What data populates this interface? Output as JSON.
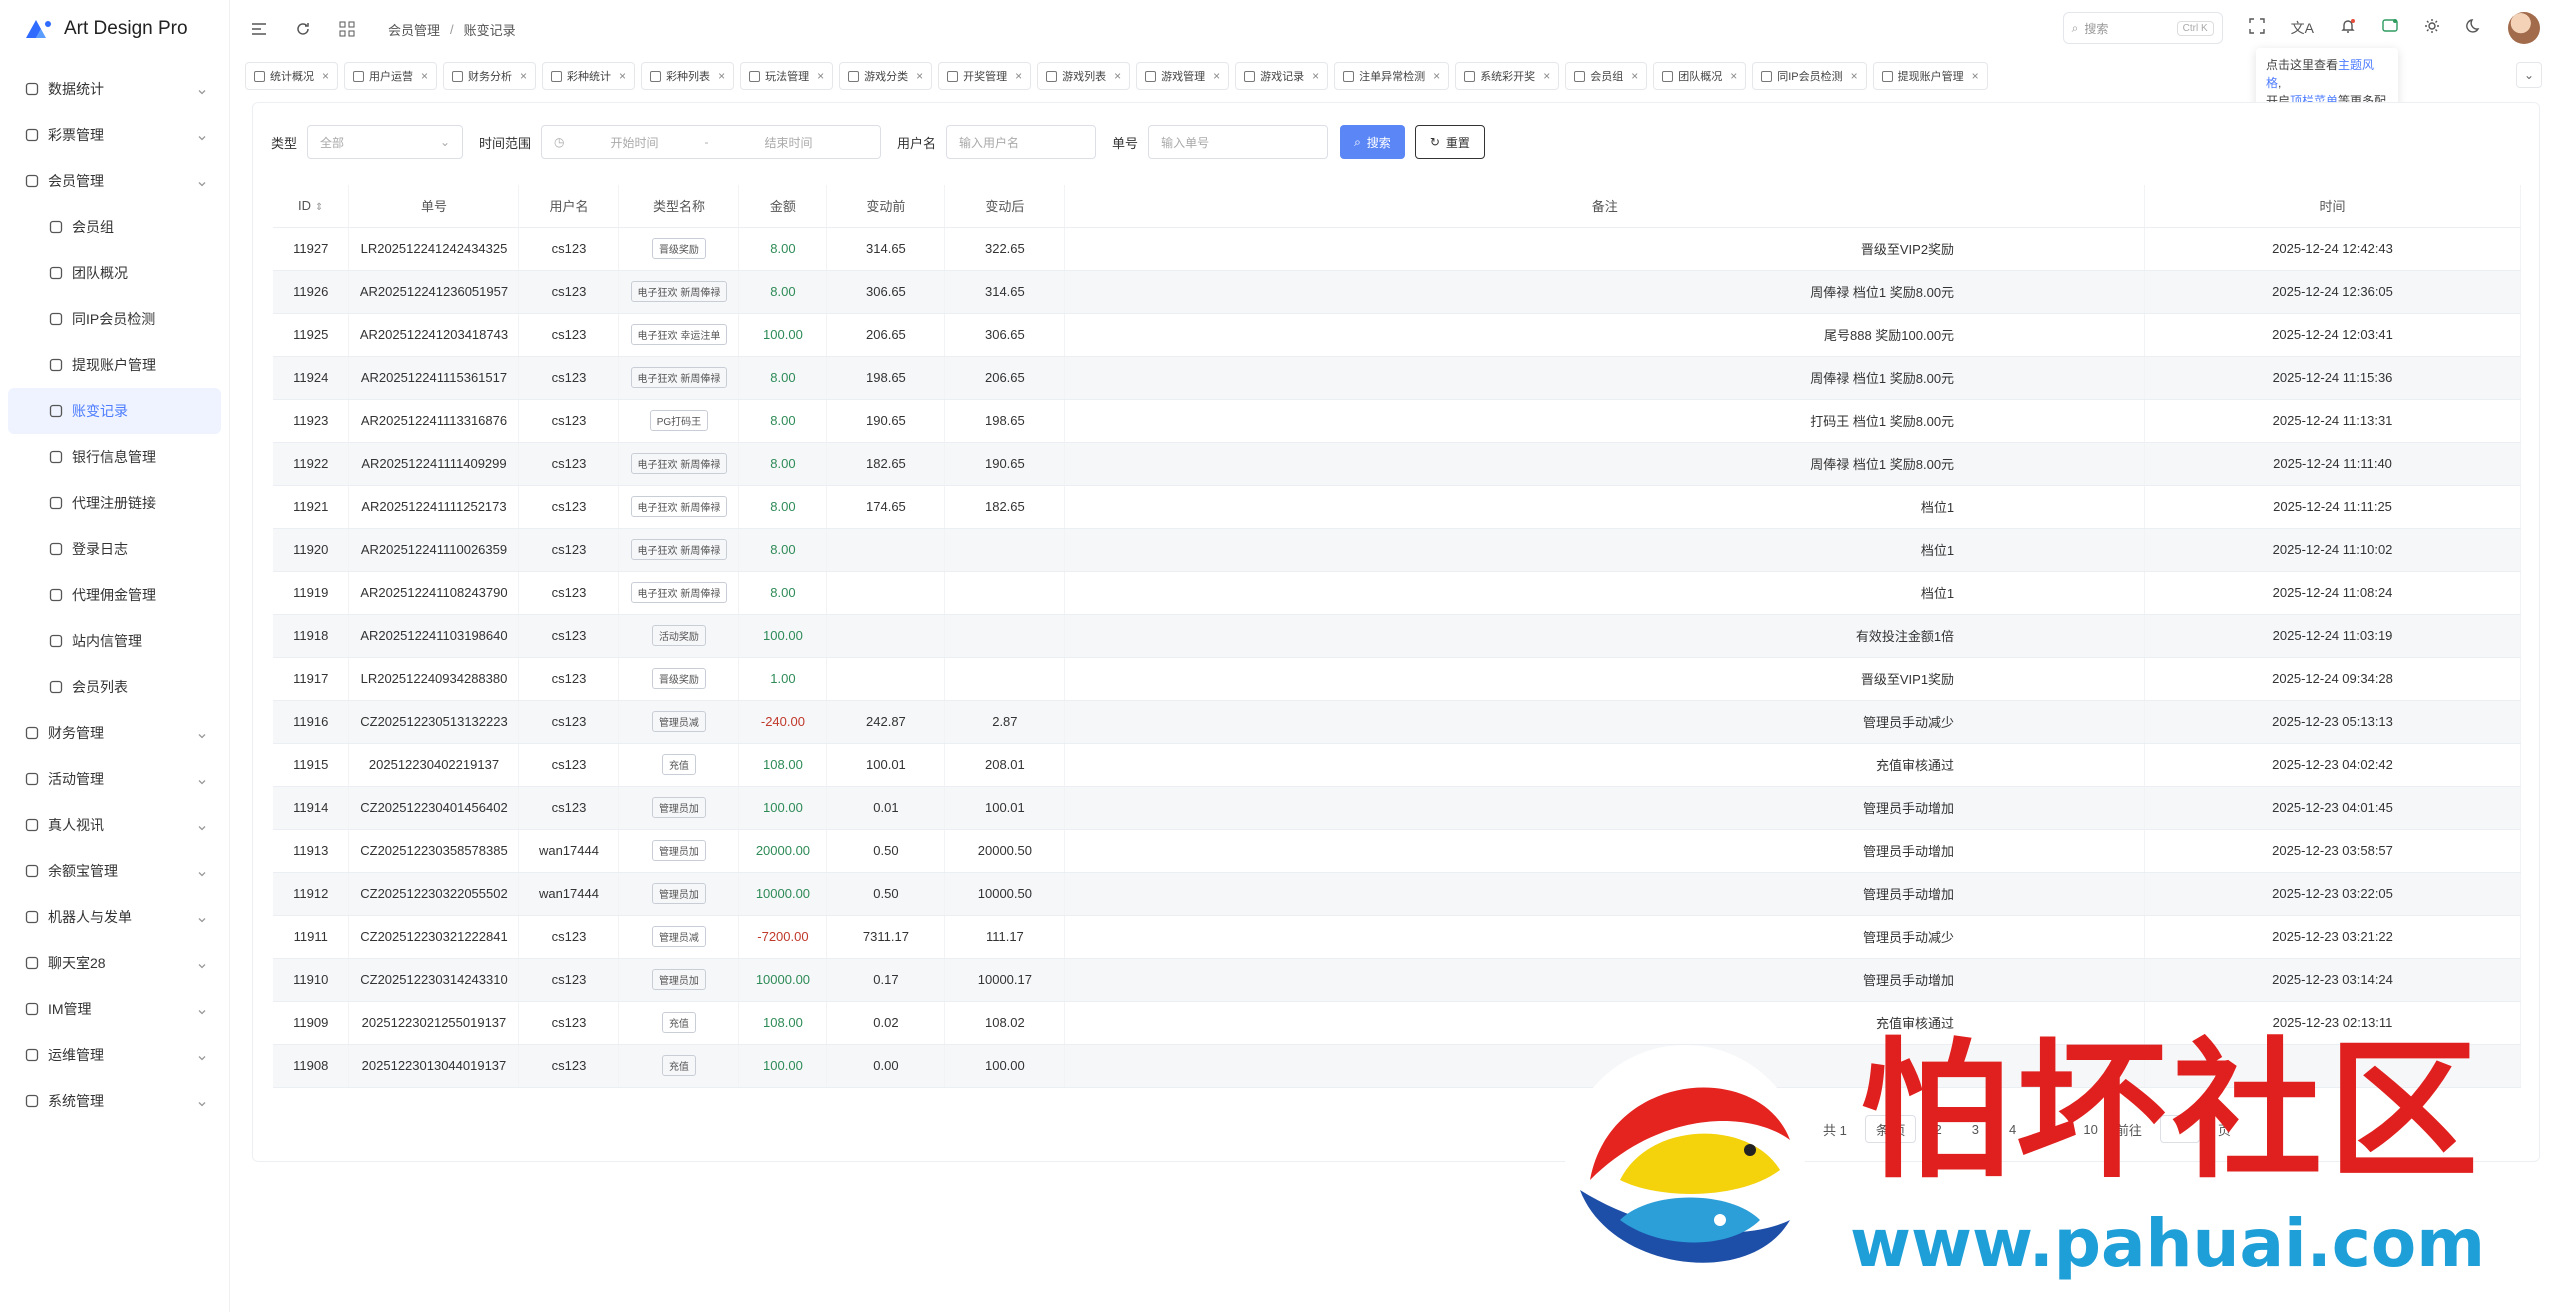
{
  "app": {
    "name": "Art Design Pro",
    "brand_color": "#4d7cff"
  },
  "sidebar": {
    "items": [
      {
        "label": "数据统计",
        "icon": "chart-icon"
      },
      {
        "label": "彩票管理",
        "icon": "ticket-icon"
      },
      {
        "label": "会员管理",
        "icon": "user-icon"
      }
    ],
    "sub_items": [
      {
        "label": "会员组",
        "icon": "users-icon"
      },
      {
        "label": "团队概况",
        "icon": "org-icon"
      },
      {
        "label": "同IP会员检测",
        "icon": "shield-icon"
      },
      {
        "label": "提现账户管理",
        "icon": "card-icon"
      },
      {
        "label": "账变记录",
        "icon": "document-icon"
      },
      {
        "label": "银行信息管理",
        "icon": "bank-icon"
      },
      {
        "label": "代理注册链接",
        "icon": "share-icon"
      },
      {
        "label": "登录日志",
        "icon": "history-icon"
      },
      {
        "label": "代理佣金管理",
        "icon": "coin-icon"
      },
      {
        "label": "站内信管理",
        "icon": "message-icon"
      },
      {
        "label": "会员列表",
        "icon": "user-icon"
      }
    ],
    "bottom_items": [
      {
        "label": "财务管理",
        "icon": "wallet-icon"
      },
      {
        "label": "活动管理",
        "icon": "gift-icon"
      },
      {
        "label": "真人视讯",
        "icon": "video-icon"
      },
      {
        "label": "余额宝管理",
        "icon": "box-icon"
      },
      {
        "label": "机器人与发单",
        "icon": "robot-icon"
      },
      {
        "label": "聊天室28",
        "icon": "chat-icon"
      },
      {
        "label": "IM管理",
        "icon": "chat-icon"
      },
      {
        "label": "运维管理",
        "icon": "tool-icon"
      },
      {
        "label": "系统管理",
        "icon": "user-icon"
      }
    ]
  },
  "header": {
    "breadcrumb": [
      "会员管理",
      "账变记录"
    ],
    "search_placeholder": "搜索",
    "search_kbd": "Ctrl K"
  },
  "tooltip": {
    "line1_pre": "点击这里查看",
    "line1_hl": "主题风格",
    "line1_post": ",",
    "line2_pre": "开启",
    "line2_hl": "顶栏菜单",
    "line2_post": "等更多配置"
  },
  "tabs": [
    "统计概况",
    "用户运营",
    "财务分析",
    "彩种统计",
    "彩种列表",
    "玩法管理",
    "游戏分类",
    "开奖管理",
    "游戏列表",
    "游戏管理",
    "游戏记录",
    "注单异常检测",
    "系统彩开奖",
    "会员组",
    "团队概况",
    "同IP会员检测",
    "提现账户管理"
  ],
  "filters": {
    "type_label": "类型",
    "type_value": "全部",
    "range_label": "时间范围",
    "start_placeholder": "开始时间",
    "range_sep": "-",
    "end_placeholder": "结束时间",
    "user_label": "用户名",
    "user_placeholder": "输入用户名",
    "order_label": "单号",
    "order_placeholder": "输入单号",
    "search_btn": "搜索",
    "reset_btn": "重置"
  },
  "table": {
    "columns": [
      "ID",
      "单号",
      "用户名",
      "类型名称",
      "金额",
      "变动前",
      "变动后",
      "备注",
      "时间"
    ],
    "rows": [
      {
        "id": "11927",
        "no": "LR202512241242434325",
        "user": "cs123",
        "type": "晋级奖励",
        "amount": "8.00",
        "before": "314.65",
        "after": "322.65",
        "remark": "晋级至VIP2奖励",
        "time": "2025-12-24 12:42:43"
      },
      {
        "id": "11926",
        "no": "AR202512241236051957",
        "user": "cs123",
        "type": "电子狂欢 新周俸禄",
        "amount": "8.00",
        "before": "306.65",
        "after": "314.65",
        "remark": "周俸禄 档位1 奖励8.00元",
        "time": "2025-12-24 12:36:05"
      },
      {
        "id": "11925",
        "no": "AR202512241203418743",
        "user": "cs123",
        "type": "电子狂欢 幸运注单",
        "amount": "100.00",
        "before": "206.65",
        "after": "306.65",
        "remark": "尾号888 奖励100.00元",
        "time": "2025-12-24 12:03:41"
      },
      {
        "id": "11924",
        "no": "AR202512241115361517",
        "user": "cs123",
        "type": "电子狂欢 新周俸禄",
        "amount": "8.00",
        "before": "198.65",
        "after": "206.65",
        "remark": "周俸禄 档位1 奖励8.00元",
        "time": "2025-12-24 11:15:36"
      },
      {
        "id": "11923",
        "no": "AR202512241113316876",
        "user": "cs123",
        "type": "PG打码王",
        "amount": "8.00",
        "before": "190.65",
        "after": "198.65",
        "remark": "打码王 档位1 奖励8.00元",
        "time": "2025-12-24 11:13:31"
      },
      {
        "id": "11922",
        "no": "AR202512241111409299",
        "user": "cs123",
        "type": "电子狂欢 新周俸禄",
        "amount": "8.00",
        "before": "182.65",
        "after": "190.65",
        "remark": "周俸禄 档位1 奖励8.00元",
        "time": "2025-12-24 11:11:40"
      },
      {
        "id": "11921",
        "no": "AR202512241111252173",
        "user": "cs123",
        "type": "电子狂欢 新周俸禄",
        "amount": "8.00",
        "before": "174.65",
        "after": "182.65",
        "remark": "档位1",
        "time": "2025-12-24 11:11:25"
      },
      {
        "id": "11920",
        "no": "AR202512241110026359",
        "user": "cs123",
        "type": "电子狂欢 新周俸禄",
        "amount": "8.00",
        "before": "",
        "after": "",
        "remark": "档位1",
        "time": "2025-12-24 11:10:02"
      },
      {
        "id": "11919",
        "no": "AR202512241108243790",
        "user": "cs123",
        "type": "电子狂欢 新周俸禄",
        "amount": "8.00",
        "before": "",
        "after": "",
        "remark": "档位1",
        "time": "2025-12-24 11:08:24"
      },
      {
        "id": "11918",
        "no": "AR202512241103198640",
        "user": "cs123",
        "type": "活动奖励",
        "amount": "100.00",
        "before": "",
        "after": "",
        "remark": "有效投注金额1倍",
        "time": "2025-12-24 11:03:19"
      },
      {
        "id": "11917",
        "no": "LR202512240934288380",
        "user": "cs123",
        "type": "晋级奖励",
        "amount": "1.00",
        "before": "",
        "after": "",
        "remark": "晋级至VIP1奖励",
        "time": "2025-12-24 09:34:28"
      },
      {
        "id": "11916",
        "no": "CZ202512230513132223",
        "user": "cs123",
        "type": "管理员减",
        "amount": "-240.00",
        "before": "242.87",
        "after": "2.87",
        "remark": "管理员手动减少",
        "time": "2025-12-23 05:13:13"
      },
      {
        "id": "11915",
        "no": "202512230402219137",
        "user": "cs123",
        "type": "充值",
        "amount": "108.00",
        "before": "100.01",
        "after": "208.01",
        "remark": "充值审核通过",
        "time": "2025-12-23 04:02:42"
      },
      {
        "id": "11914",
        "no": "CZ202512230401456402",
        "user": "cs123",
        "type": "管理员加",
        "amount": "100.00",
        "before": "0.01",
        "after": "100.01",
        "remark": "管理员手动增加",
        "time": "2025-12-23 04:01:45"
      },
      {
        "id": "11913",
        "no": "CZ202512230358578385",
        "user": "wan17444",
        "type": "管理员加",
        "amount": "20000.00",
        "before": "0.50",
        "after": "20000.50",
        "remark": "管理员手动增加",
        "time": "2025-12-23 03:58:57"
      },
      {
        "id": "11912",
        "no": "CZ202512230322055502",
        "user": "wan17444",
        "type": "管理员加",
        "amount": "10000.00",
        "before": "0.50",
        "after": "10000.50",
        "remark": "管理员手动增加",
        "time": "2025-12-23 03:22:05"
      },
      {
        "id": "11911",
        "no": "CZ202512230321222841",
        "user": "cs123",
        "type": "管理员减",
        "amount": "-7200.00",
        "before": "7311.17",
        "after": "111.17",
        "remark": "管理员手动减少",
        "time": "2025-12-23 03:21:22"
      },
      {
        "id": "11910",
        "no": "CZ202512230314243310",
        "user": "cs123",
        "type": "管理员加",
        "amount": "10000.00",
        "before": "0.17",
        "after": "10000.17",
        "remark": "管理员手动增加",
        "time": "2025-12-23 03:14:24"
      },
      {
        "id": "11909",
        "no": "202512230212550191​37",
        "user": "cs123",
        "type": "充值",
        "amount": "108.00",
        "before": "0.02",
        "after": "108.02",
        "remark": "充值审核通过",
        "time": "2025-12-23 02:13:11"
      },
      {
        "id": "11908",
        "no": "202512230130440191​37",
        "user": "cs123",
        "type": "充值",
        "amount": "100.00",
        "before": "0.00",
        "after": "100.00",
        "remark": "",
        "time": ""
      }
    ]
  },
  "pagination": {
    "total_prefix": "共 1",
    "page_size": "条/页",
    "pages": [
      "2",
      "3",
      "4",
      "6",
      "10"
    ],
    "goto_label": "前往",
    "page_suffix": "页"
  },
  "watermark": {
    "title": "怕坏社区",
    "url": "www.pahuai.com"
  },
  "colors": {
    "positive": "#2e8b57",
    "negative": "#c0392b",
    "primary_btn": "#5b86f5"
  }
}
